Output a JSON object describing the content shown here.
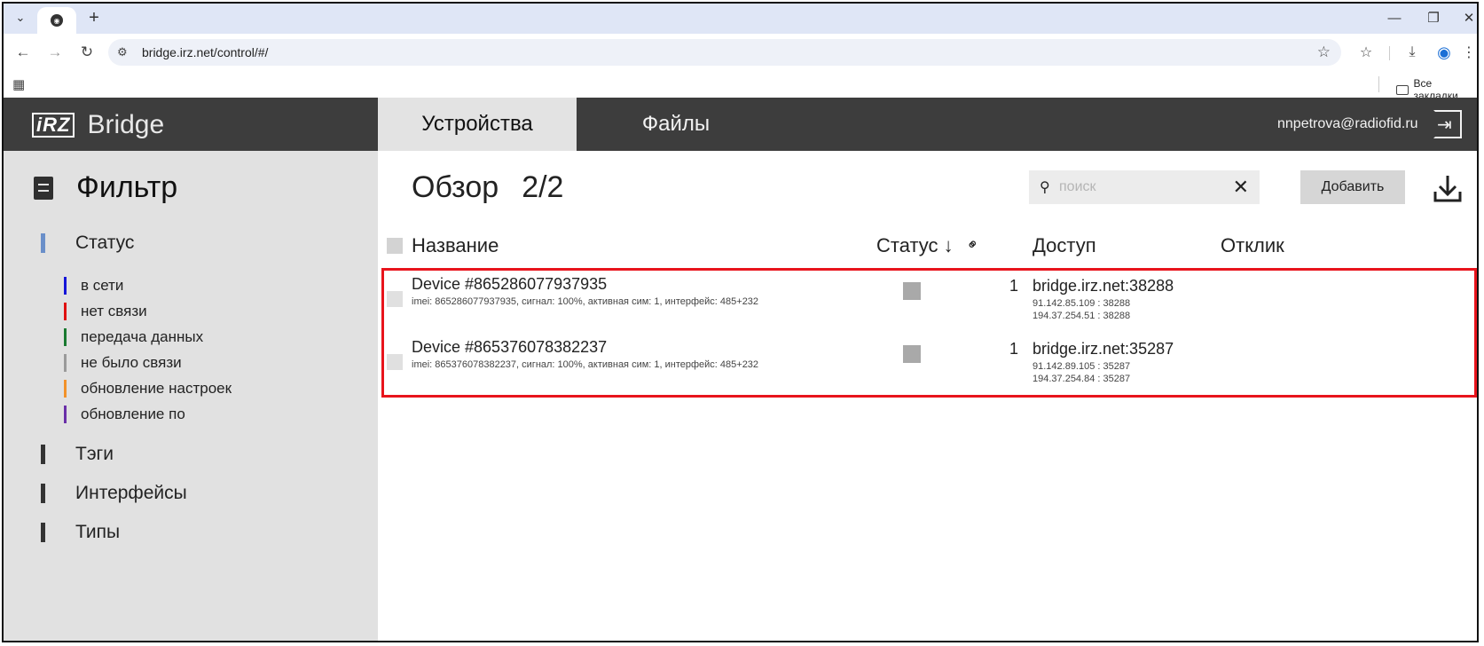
{
  "browser": {
    "url": "bridge.irz.net/control/#/",
    "bookmarks_all": "Все закладки"
  },
  "app": {
    "logo": "iRZ",
    "brand": "Bridge",
    "nav": {
      "devices": "Устройства",
      "files": "Файлы"
    },
    "user_email": "nnpetrova@radiofid.ru"
  },
  "sidebar": {
    "title": "Фильтр",
    "groups": {
      "status": "Статус",
      "tags": "Тэги",
      "interfaces": "Интерфейсы",
      "types": "Типы"
    },
    "statuses": [
      {
        "label": "в сети",
        "color": "#1515d8"
      },
      {
        "label": "нет связи",
        "color": "#e01010"
      },
      {
        "label": "передача данных",
        "color": "#1a7a30"
      },
      {
        "label": "не было связи",
        "color": "#9a9a9a"
      },
      {
        "label": "обновление настроек",
        "color": "#f2922a"
      },
      {
        "label": "обновление по",
        "color": "#6a2fa8"
      }
    ]
  },
  "main": {
    "title": "Обзор",
    "count": "2/2",
    "search_placeholder": "поиск",
    "add_label": "Добавить",
    "columns": {
      "name": "Название",
      "status": "Статус ↓",
      "access": "Доступ",
      "response": "Отклик"
    },
    "devices": [
      {
        "name": "Device #865286077937935",
        "info": "imei: 865286077937935, сигнал: 100%, активная сим: 1, интерфейс: 485+232",
        "links": "1",
        "access": "bridge.irz.net:38288",
        "ip1": "91.142.85.109 : 38288",
        "ip2": "194.37.254.51 : 38288"
      },
      {
        "name": "Device #865376078382237",
        "info": "imei: 865376078382237, сигнал: 100%, активная сим: 1, интерфейс: 485+232",
        "links": "1",
        "access": "bridge.irz.net:35287",
        "ip1": "91.142.89.105 : 35287",
        "ip2": "194.37.254.84 : 35287"
      }
    ]
  }
}
